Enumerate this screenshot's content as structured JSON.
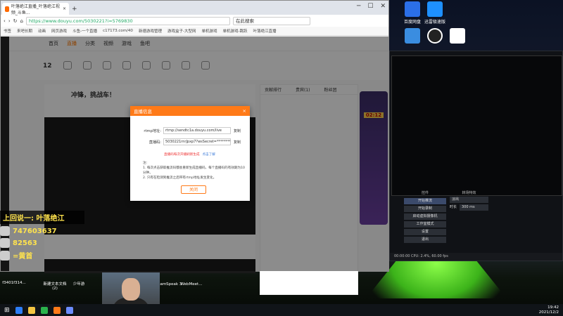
{
  "browser": {
    "tab_title": "叶落绝江直播_叶落绝江视频_斗鱼...",
    "url": "https://www.douyu.com/5030221?i=5769830",
    "search_placeholder": "在此搜索",
    "bookmarks": [
      "书签",
      "来吧长期",
      "动画",
      "网页游戏",
      "斗鱼-一个直播",
      "c17173.com/40",
      "新德游戏管理",
      "游戏盒子-大型网",
      "单机游戏",
      "单机游戏-跳跃",
      "叶落绝江直播"
    ],
    "tabs_nav": [
      "首页",
      "直播",
      "分类",
      "视频",
      "游戏",
      "鱼吧"
    ]
  },
  "page": {
    "category_count": "12",
    "room_slogan": "冲锋，挑战车！",
    "chat_tabs": [
      "贡献排行",
      "贵宾(1)",
      "粉丝团"
    ],
    "side_badge_text": "02:12"
  },
  "dialog": {
    "title": "直播信息",
    "close_icon": "×",
    "rtmp_label": "rtmp地址:",
    "rtmp_value": "rtmp://sendtc1a.douyu.com/live",
    "code_label": "直播码:",
    "code_value": "5030221rnrJpxp7?wsSecret=**********",
    "copy_label": "复制",
    "warn_text": "直播码每次开播刷新生成",
    "warn_link": "点击了解",
    "note_title": "注:",
    "note_1": "1. 每次点击获取推流码都会重新生成直播码，每个直播码的有效期为10分钟。",
    "note_2": "2. 只有在检测到推流之后带有rtmp地址发生变化。",
    "confirm_label": "关闭"
  },
  "overlay": {
    "title": "上回说一: 叶落绝江",
    "line1": "747603637",
    "line2": "82563",
    "line3": "=黄首"
  },
  "obs": {
    "controls_title": "控件",
    "controls": [
      "开始推流",
      "开始录制",
      "启动虚拟摄像机",
      "工作室模式",
      "设置",
      "退出"
    ],
    "transitions_title": "转场特效",
    "transition_value": "淡出",
    "duration_label": "时长",
    "duration_value": "300 ms",
    "status": "00:00:00   CPU: 2.4%, 60.00 fps"
  },
  "desktop_icons": [
    "百度网盘",
    "迅雷极速版"
  ],
  "desktop_bottom": [
    "f3401f314...",
    "新建文本文档 (2)",
    "少年游",
    "TeamSpeak 3",
    "WebMeet..."
  ],
  "clock": {
    "time": "19:42",
    "date": "2021/12/2"
  }
}
